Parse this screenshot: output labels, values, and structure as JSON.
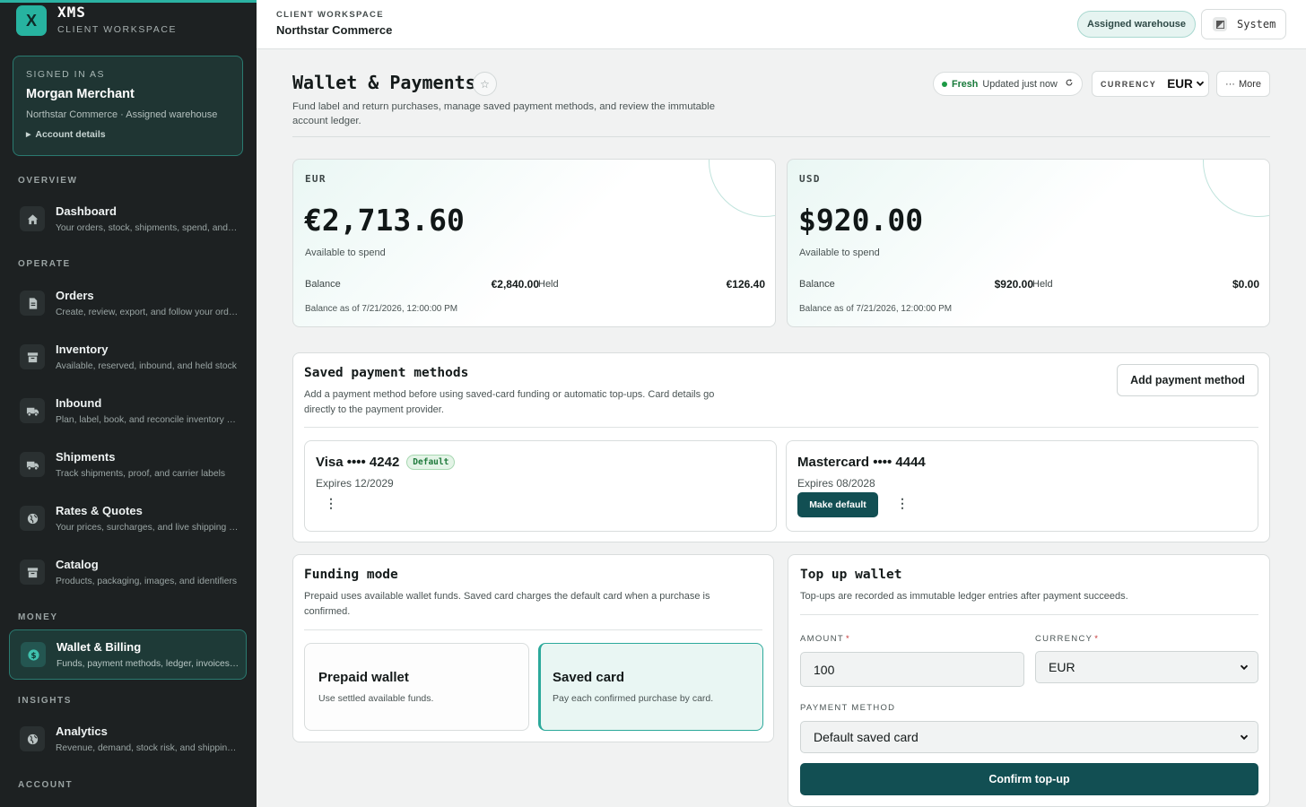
{
  "brand": {
    "logo_letter": "X",
    "name": "XMS",
    "subtitle": "CLIENT WORKSPACE",
    "accent": "#27b3a0"
  },
  "signed_in": {
    "label": "SIGNED IN AS",
    "name": "Morgan Merchant",
    "meta": "Northstar Commerce · Assigned warehouse",
    "link": "Account details"
  },
  "nav": {
    "sections": [
      "OVERVIEW",
      "OPERATE",
      "MONEY",
      "INSIGHTS",
      "ACCOUNT"
    ],
    "items": [
      {
        "title": "Dashboard",
        "desc": "Your orders, stock, shipments, spend, and s...",
        "icon": "home-icon"
      },
      {
        "title": "Orders",
        "desc": "Create, review, export, and follow your orders",
        "icon": "document-icon"
      },
      {
        "title": "Inventory",
        "desc": "Available, reserved, inbound, and held stock",
        "icon": "box-icon"
      },
      {
        "title": "Inbound",
        "desc": "Plan, label, book, and reconcile inventory ar...",
        "icon": "truck-icon"
      },
      {
        "title": "Shipments",
        "desc": "Track shipments, proof, and carrier labels",
        "icon": "truck-icon"
      },
      {
        "title": "Rates & Quotes",
        "desc": "Your prices, surcharges, and live shipping q...",
        "icon": "globe-icon"
      },
      {
        "title": "Catalog",
        "desc": "Products, packaging, images, and identifiers",
        "icon": "box-icon"
      },
      {
        "title": "Wallet & Billing",
        "desc": "Funds, payment methods, ledger, invoices, ...",
        "icon": "dollar-icon",
        "active": true
      },
      {
        "title": "Analytics",
        "desc": "Revenue, demand, stock risk, and shipping ...",
        "icon": "globe-icon"
      }
    ]
  },
  "topbar": {
    "workspace_label": "CLIENT WORKSPACE",
    "workspace_name": "Northstar Commerce",
    "warehouse_pill": "Assigned warehouse",
    "theme_button": "System"
  },
  "page": {
    "title": "Wallet & Payments",
    "description": "Fund label and return purchases, manage saved payment methods, and review the immutable account ledger.",
    "fresh_label": "Fresh",
    "updated": "Updated just now",
    "currency_label": "CURRENCY",
    "currency_value": "EUR",
    "more_label": "More"
  },
  "balances": [
    {
      "code": "EUR",
      "amount": "€2,713.60",
      "available_label": "Available to spend",
      "balance_label": "Balance",
      "balance": "€2,840.00",
      "held_label": "Held",
      "held": "€126.40",
      "as_of": "Balance as of 7/21/2026, 12:00:00 PM"
    },
    {
      "code": "USD",
      "amount": "$920.00",
      "available_label": "Available to spend",
      "balance_label": "Balance",
      "balance": "$920.00",
      "held_label": "Held",
      "held": "$0.00",
      "as_of": "Balance as of 7/21/2026, 12:00:00 PM"
    }
  ],
  "payment_methods": {
    "title": "Saved payment methods",
    "description": "Add a payment method before using saved-card funding or automatic top-ups. Card details go directly to the payment provider.",
    "add_button": "Add payment method",
    "cards": [
      {
        "name": "Visa •••• 4242",
        "badge": "Default",
        "expires": "Expires 12/2029"
      },
      {
        "name": "Mastercard •••• 4444",
        "expires": "Expires 08/2028",
        "action": "Make default"
      }
    ]
  },
  "funding": {
    "title": "Funding mode",
    "description": "Prepaid uses available wallet funds. Saved card charges the default card when a purchase is confirmed.",
    "options": [
      {
        "title": "Prepaid wallet",
        "desc": "Use settled available funds.",
        "selected": false
      },
      {
        "title": "Saved card",
        "desc": "Pay each confirmed purchase by card.",
        "selected": true
      }
    ]
  },
  "topup": {
    "title": "Top up wallet",
    "description": "Top-ups are recorded as immutable ledger entries after payment succeeds.",
    "amount_label": "AMOUNT",
    "amount_value": "100",
    "currency_label": "CURRENCY",
    "currency_value": "EUR",
    "method_label": "PAYMENT METHOD",
    "method_value": "Default saved card",
    "confirm": "Confirm top-up",
    "required_mark": "*"
  }
}
